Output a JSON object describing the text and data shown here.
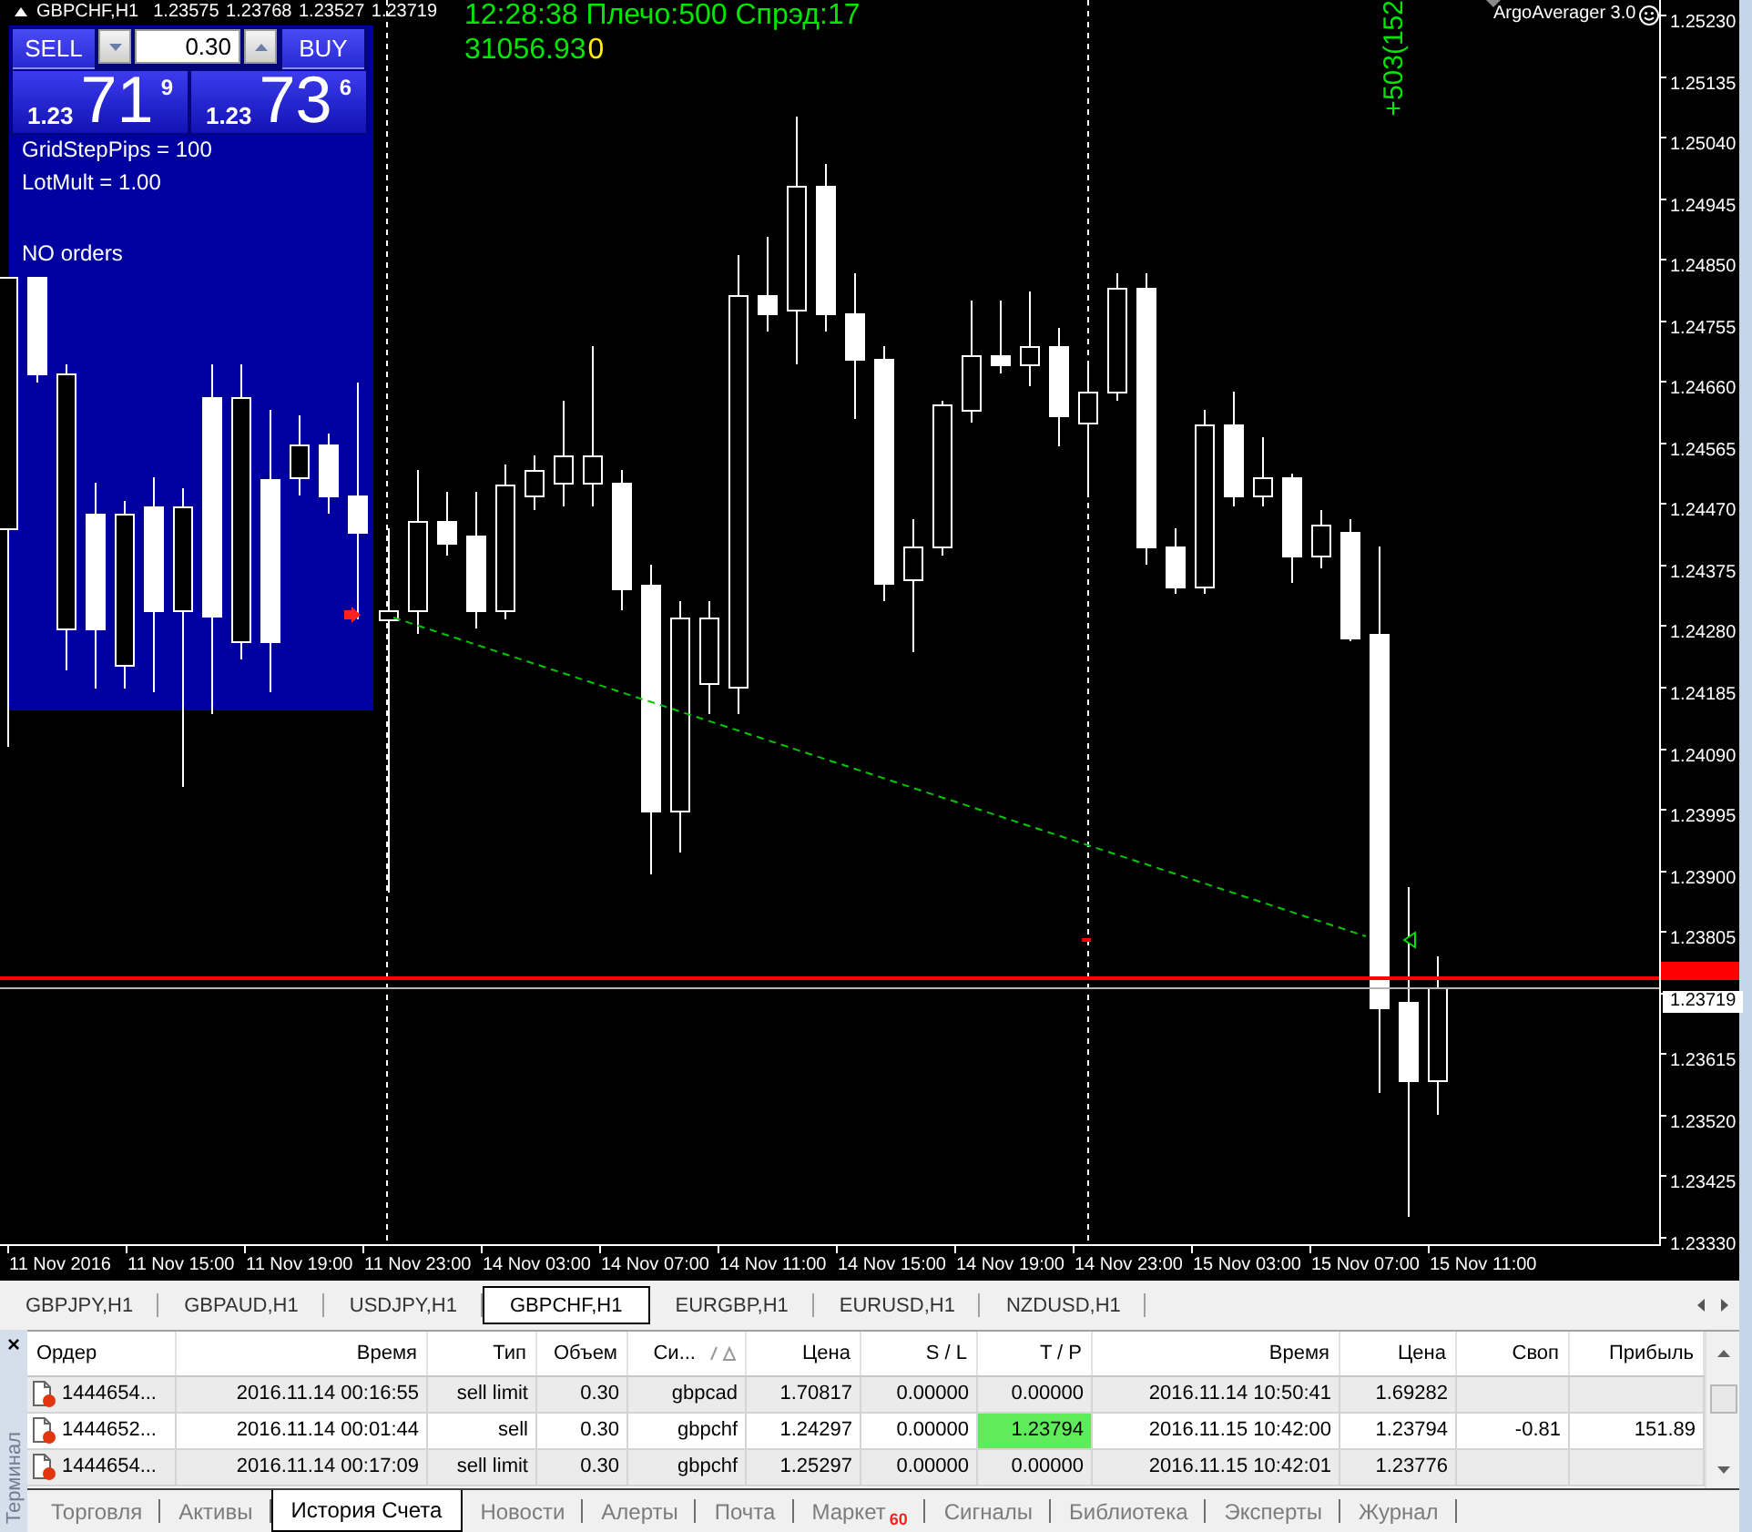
{
  "chart": {
    "symbol": "GBPCHF,H1",
    "ohlc": "1.23575 1.23768 1.23527 1.23719",
    "status_line": "12:28:38 Плечо:500 Спрэд:17",
    "balance": "31056.93",
    "balance_flag": "0",
    "vertical_label": "+503(152",
    "expert_name": "ArgoAverager 3.0",
    "info_panel": {
      "lines": [
        "GridStepPips = 100",
        "LotMult = 1.00"
      ],
      "status": "NO orders"
    },
    "trade_panel": {
      "sell": "SELL",
      "buy": "BUY",
      "lot": "0.30",
      "bid": {
        "prefix": "1.23",
        "pips": "71",
        "point": "9"
      },
      "ask": {
        "prefix": "1.23",
        "pips": "73",
        "point": "6"
      }
    },
    "price_axis": [
      {
        "label": "1.25230",
        "kind": "tick"
      },
      {
        "label": "1.25135",
        "kind": "tick"
      },
      {
        "label": "1.25040",
        "kind": "tick"
      },
      {
        "label": "1.24945",
        "kind": "tick"
      },
      {
        "label": "1.24850",
        "kind": "tick"
      },
      {
        "label": "1.24755",
        "kind": "tick"
      },
      {
        "label": "1.24660",
        "kind": "tick"
      },
      {
        "label": "1.24565",
        "kind": "tick"
      },
      {
        "label": "1.24470",
        "kind": "tick"
      },
      {
        "label": "1.24375",
        "kind": "tick"
      },
      {
        "label": "1.24280",
        "kind": "tick"
      },
      {
        "label": "1.24185",
        "kind": "tick"
      },
      {
        "label": "1.24090",
        "kind": "tick"
      },
      {
        "label": "1.23995",
        "kind": "tick"
      },
      {
        "label": "1.23900",
        "kind": "tick"
      },
      {
        "label": "1.23805",
        "kind": "tick"
      },
      {
        "label": "1.23719",
        "kind": "current"
      },
      {
        "label": "1.23615",
        "kind": "tick"
      },
      {
        "label": "1.23520",
        "kind": "tick"
      },
      {
        "label": "1.23425",
        "kind": "tick"
      },
      {
        "label": "1.23330",
        "kind": "tick"
      }
    ],
    "time_axis": [
      "11 Nov 2016",
      "11 Nov 15:00",
      "11 Nov 19:00",
      "11 Nov 23:00",
      "14 Nov 03:00",
      "14 Nov 07:00",
      "14 Nov 11:00",
      "14 Nov 15:00",
      "14 Nov 19:00",
      "14 Nov 23:00",
      "15 Nov 03:00",
      "15 Nov 07:00",
      "15 Nov 11:00"
    ]
  },
  "chart_tabs": [
    {
      "label": "GBPJPY,H1",
      "selected": false
    },
    {
      "label": "GBPAUD,H1",
      "selected": false
    },
    {
      "label": "USDJPY,H1",
      "selected": false
    },
    {
      "label": "GBPCHF,H1",
      "selected": true
    },
    {
      "label": "EURGBP,H1",
      "selected": false
    },
    {
      "label": "EURUSD,H1",
      "selected": false
    },
    {
      "label": "NZDUSD,H1",
      "selected": false
    }
  ],
  "terminal": {
    "close": "×",
    "title": "Терминал",
    "columns": [
      {
        "label": "Ордер",
        "sorted": false
      },
      {
        "label": "Время",
        "sorted": false
      },
      {
        "label": "Тип",
        "sorted": false
      },
      {
        "label": "Объем",
        "sorted": false
      },
      {
        "label": "Си...",
        "sorted": true
      },
      {
        "label": "Цена",
        "sorted": false
      },
      {
        "label": "S / L",
        "sorted": false
      },
      {
        "label": "T / P",
        "sorted": false
      },
      {
        "label": "Время",
        "sorted": false
      },
      {
        "label": "Цена",
        "sorted": false
      },
      {
        "label": "Своп",
        "sorted": false
      },
      {
        "label": "Прибыль",
        "sorted": false
      }
    ],
    "rows": [
      {
        "order": "1444654...",
        "open_time": "2016.11.14 00:16:55",
        "type": "sell limit",
        "volume": "0.30",
        "symbol": "gbpcad",
        "price": "1.70817",
        "sl": "0.00000",
        "tp": "0.00000",
        "close_time": "2016.11.14 10:50:41",
        "close_price": "1.69282",
        "tp_highlighted": false
      },
      {
        "order": "1444652...",
        "open_time": "2016.11.14 00:01:44",
        "type": "sell",
        "volume": "0.30",
        "symbol": "gbpchf",
        "price": "1.24297",
        "sl": "0.00000",
        "tp": "1.23794",
        "close_time": "2016.11.15 10:42:00",
        "close_price": "1.23794",
        "swap": "-0.81",
        "profit": "151.89",
        "tp_highlighted": true
      },
      {
        "order": "1444654...",
        "open_time": "2016.11.14 00:17:09",
        "type": "sell limit",
        "volume": "0.30",
        "symbol": "gbpchf",
        "price": "1.25297",
        "sl": "0.00000",
        "tp": "0.00000",
        "close_time": "2016.11.15 10:42:01",
        "close_price": "1.23776",
        "tp_highlighted": false
      }
    ],
    "tabs": [
      {
        "label": "Торговля",
        "selected": false
      },
      {
        "label": "Активы",
        "selected": false
      },
      {
        "label": "История Счета",
        "selected": true
      },
      {
        "label": "Новости",
        "selected": false
      },
      {
        "label": "Алерты",
        "selected": false
      },
      {
        "label": "Почта",
        "selected": false
      },
      {
        "label": "Маркет",
        "selected": false,
        "badge": "60"
      },
      {
        "label": "Сигналы",
        "selected": false
      },
      {
        "label": "Библиотека",
        "selected": false
      },
      {
        "label": "Эксперты",
        "selected": false
      },
      {
        "label": "Журнал",
        "selected": false
      }
    ]
  }
}
